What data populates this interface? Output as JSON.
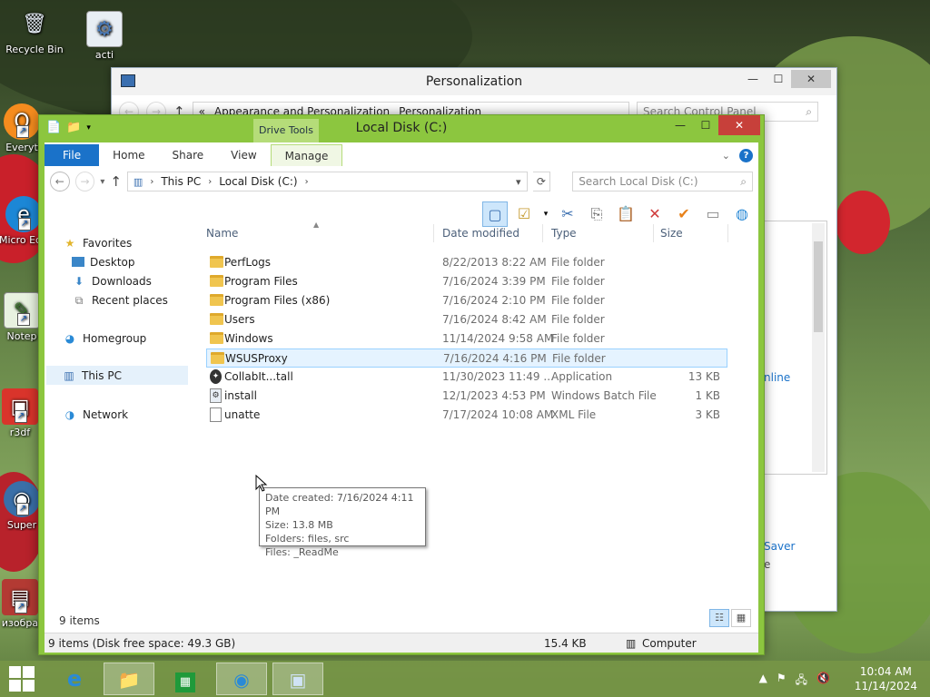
{
  "desktop": {
    "icons": [
      {
        "label": "Recycle Bin",
        "glyph": "🗑"
      },
      {
        "label": "acti",
        "glyph": "⚙"
      },
      {
        "label": "Everyt",
        "glyph": "Q"
      },
      {
        "label": "Micro Edg",
        "glyph": "e"
      },
      {
        "label": "Notep",
        "glyph": "✎"
      },
      {
        "label": "r3df",
        "glyph": "▣"
      },
      {
        "label": "Super",
        "glyph": "◉"
      },
      {
        "label": "изобра",
        "glyph": "▤"
      }
    ]
  },
  "background_window": {
    "title": "Personalization",
    "breadcrumb": [
      "«",
      "Appearance and Personalization",
      "Personalization"
    ],
    "search_placeholder": "Search Control Panel",
    "side_link": "nline",
    "side_text1": "Saver",
    "side_text2": "e"
  },
  "explorer": {
    "title": "Local Disk (C:)",
    "contextual_tab": "Drive Tools",
    "tabs": [
      "File",
      "Home",
      "Share",
      "View",
      "Manage"
    ],
    "address": [
      "This PC",
      "Local Disk (C:)"
    ],
    "search_placeholder": "Search Local Disk (C:)",
    "nav": {
      "favorites": "Favorites",
      "desktop": "Desktop",
      "downloads": "Downloads",
      "recent": "Recent places",
      "homegroup": "Homegroup",
      "this_pc": "This PC",
      "network": "Network"
    },
    "columns": {
      "name": "Name",
      "date": "Date modified",
      "type": "Type",
      "size": "Size"
    },
    "rows": [
      {
        "name": "PerfLogs",
        "date": "8/22/2013 8:22 AM",
        "type": "File folder",
        "size": "",
        "kind": "folder"
      },
      {
        "name": "Program Files",
        "date": "7/16/2024 3:39 PM",
        "type": "File folder",
        "size": "",
        "kind": "folder"
      },
      {
        "name": "Program Files (x86)",
        "date": "7/16/2024 2:10 PM",
        "type": "File folder",
        "size": "",
        "kind": "folder"
      },
      {
        "name": "Users",
        "date": "7/16/2024 8:42 AM",
        "type": "File folder",
        "size": "",
        "kind": "folder"
      },
      {
        "name": "Windows",
        "date": "11/14/2024 9:58 AM",
        "type": "File folder",
        "size": "",
        "kind": "folder"
      },
      {
        "name": "WSUSProxy",
        "date": "7/16/2024 4:16 PM",
        "type": "File folder",
        "size": "",
        "kind": "folder"
      },
      {
        "name": "CollabIt...tall",
        "date": "11/30/2023 11:49 ...",
        "type": "Application",
        "size": "13 KB",
        "kind": "app"
      },
      {
        "name": "install",
        "date": "12/1/2023 4:53 PM",
        "type": "Windows Batch File",
        "size": "1 KB",
        "kind": "bat"
      },
      {
        "name": "unatte",
        "date": "7/17/2024 10:08 AM",
        "type": "XML File",
        "size": "3 KB",
        "kind": "xml"
      }
    ],
    "tooltip": {
      "line1": "Date created: 7/16/2024 4:11 PM",
      "line2": "Size: 13.8 MB",
      "line3": "Folders: files, src",
      "line4": "Files: _ReadMe"
    },
    "items_count": "9 items",
    "status": {
      "left": "9 items (Disk free space: 49.3 GB)",
      "size": "15.4 KB",
      "location": "Computer"
    }
  },
  "taskbar": {
    "clock_time": "10:04 AM",
    "clock_date": "11/14/2024"
  }
}
